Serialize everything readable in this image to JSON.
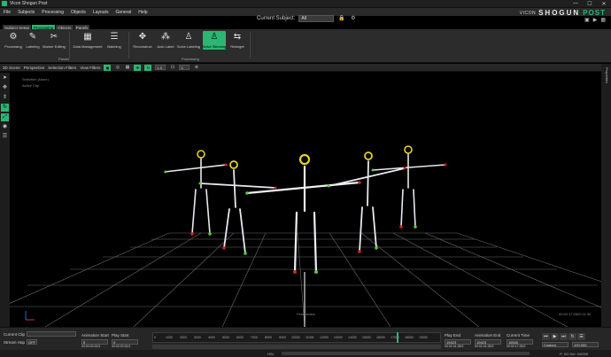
{
  "app": {
    "title": "Vicon Shogun Post"
  },
  "window": {
    "minimize": "—",
    "maximize": "☐",
    "close": "✕"
  },
  "menu": [
    "File",
    "Subjects",
    "Processing",
    "Objects",
    "Layouts",
    "General",
    "Help"
  ],
  "subject": {
    "label": "Current Subject:",
    "value": "All"
  },
  "brand": {
    "vicon": "VICON",
    "shogun": "SHOGUN",
    "post": "POST"
  },
  "tabs": [
    {
      "label": "Subject Setup",
      "active": false
    },
    {
      "label": "Processing",
      "active": true
    },
    {
      "label": "Objects",
      "active": false
    },
    {
      "label": "Panels",
      "active": false
    }
  ],
  "ribbon": {
    "buttons": [
      {
        "label": "Processing",
        "icon": "⚙"
      },
      {
        "label": "Labeling",
        "icon": "✎"
      },
      {
        "label": "Marker Editing",
        "icon": "✂"
      },
      {
        "label": "Data Management",
        "icon": "▦"
      },
      {
        "label": "Batching",
        "icon": "☰"
      },
      {
        "label": "Reconstruct",
        "icon": "✥"
      },
      {
        "label": "Auto Label",
        "icon": "⁂"
      },
      {
        "label": "Solve Labeling",
        "icon": "♙"
      },
      {
        "label": "Solve Skinning",
        "icon": "♙"
      },
      {
        "label": "Retarget",
        "icon": "⇆"
      }
    ],
    "sections": [
      "Panels",
      "Processing"
    ]
  },
  "viewtoolbar": {
    "items": [
      "3D Scene",
      "Perspective",
      "Selection Filters",
      "View Filters"
    ],
    "field1": "1.0",
    "field2": "0"
  },
  "viewport": {
    "overlay_lines": [
      "Selection (None)",
      "Active Clip"
    ],
    "camera_label": "Perspective",
    "timecode": "00:02:17:2502:11.90"
  },
  "rightbar": {
    "label": "Properties"
  },
  "timeline": {
    "current_clip_label": "Current Clip",
    "stream_hap_label": "Stream Hap",
    "stream_hap_value": "OFF",
    "animation_start_label": "Animation Start",
    "animation_start_value": "0",
    "animation_start_tc": "00:00:00:00/1",
    "play_start_label": "Play Start",
    "play_start_value": "0",
    "play_start_tc": "00:00:00:00/1",
    "play_end_label": "Play End",
    "play_end_value": "19423",
    "play_end_tc": "00:02:41:28/2",
    "animation_end_label": "Animation End",
    "animation_end_value": "19423",
    "animation_end_tc": "00:02:41:28/2",
    "current_time_label": "Current Time",
    "current_time_value": "16540",
    "current_time_tc": "00:02:17:25/2",
    "ticks": [
      "0",
      "1000",
      "2000",
      "3000",
      "4000",
      "5000",
      "6000",
      "7000",
      "8000",
      "9000",
      "10000",
      "11000",
      "12000",
      "13000",
      "14000",
      "15000",
      "16000",
      "17000",
      "18000",
      "19000"
    ],
    "speed": "120.000",
    "mode": "Custom"
  },
  "status": {
    "left": "HSL",
    "right": "P: 0/0 Sel: 0/6288"
  },
  "colors": {
    "accent": "#2bb673",
    "grid": "#7a7a7a",
    "bone": "#e8e8ee",
    "marker_red": "#d42020",
    "marker_green": "#59c83a",
    "marker_yellow": "#e6d21c"
  }
}
